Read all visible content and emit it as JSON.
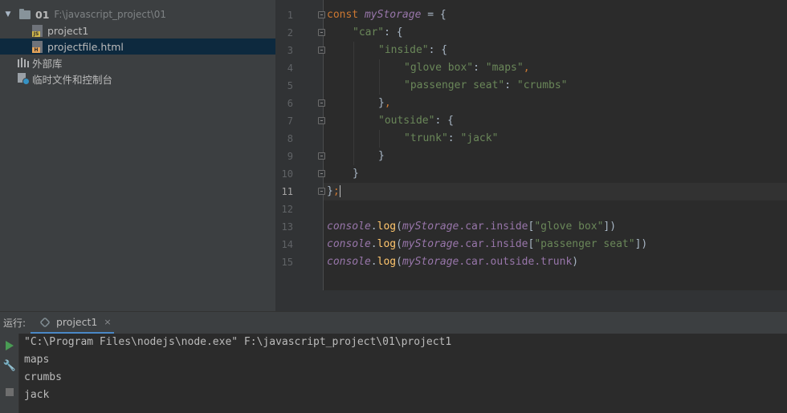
{
  "project_tree": {
    "root": {
      "name": "01",
      "path": "F:\\javascript_project\\01"
    },
    "files": [
      {
        "name": "project1",
        "type": "js",
        "badge": "JS"
      },
      {
        "name": "projectfile.html",
        "type": "html",
        "badge": "H"
      }
    ],
    "external_libs": "外部库",
    "scratches": "临时文件和控制台"
  },
  "editor": {
    "line_numbers": [
      "1",
      "2",
      "3",
      "4",
      "5",
      "6",
      "7",
      "8",
      "9",
      "10",
      "11",
      "12",
      "13",
      "14",
      "15"
    ],
    "current_line": "11",
    "code": {
      "l1": {
        "kw": "const",
        "var": "myStorage",
        "rest": " = {"
      },
      "l2": {
        "key": "\"car\"",
        "rest": ": {"
      },
      "l3": {
        "key": "\"inside\"",
        "rest": ": {"
      },
      "l4": {
        "key": "\"glove box\"",
        "sep": ": ",
        "val": "\"maps\"",
        "end": ","
      },
      "l5": {
        "key": "\"passenger seat\"",
        "sep": ": ",
        "val": "\"crumbs\""
      },
      "l6": {
        "text": "},",
        "brace": "}",
        "comma": ","
      },
      "l7": {
        "key": "\"outside\"",
        "rest": ": {"
      },
      "l8": {
        "key": "\"trunk\"",
        "sep": ": ",
        "val": "\"jack\""
      },
      "l9": {
        "text": "}"
      },
      "l10": {
        "text": "}"
      },
      "l11": {
        "text": "};",
        "brace": "}",
        "semi": ";"
      },
      "l13": {
        "obj": "console",
        "dot": ".",
        "fn": "log",
        "open": "(",
        "var": "myStorage",
        "p1": ".car",
        "p2": ".inside",
        "bopen": "[",
        "str": "\"glove box\"",
        "close": "])"
      },
      "l14": {
        "obj": "console",
        "dot": ".",
        "fn": "log",
        "open": "(",
        "var": "myStorage",
        "p1": ".car",
        "p2": ".inside",
        "bopen": "[",
        "str": "\"passenger seat\"",
        "close": "])"
      },
      "l15": {
        "obj": "console",
        "dot": ".",
        "fn": "log",
        "open": "(",
        "var": "myStorage",
        "p1": ".car",
        "p2": ".outside",
        "p3": ".trunk",
        "close": ")"
      }
    }
  },
  "run_panel": {
    "label": "运行:",
    "tab_name": "project1",
    "close_glyph": "×",
    "output": [
      "\"C:\\Program Files\\nodejs\\node.exe\" F:\\javascript_project\\01\\project1",
      "maps",
      "crumbs",
      "jack"
    ]
  },
  "colors": {
    "keyword": "#cc7832",
    "variable": "#9876aa",
    "string": "#6a8759",
    "function": "#ffc66d",
    "selection": "#0d293e",
    "run_green": "#499c54"
  }
}
